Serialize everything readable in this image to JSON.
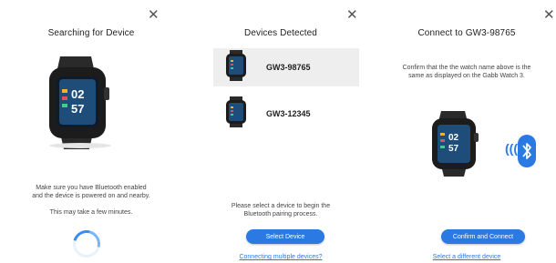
{
  "colors": {
    "accent": "#2b79e3",
    "selected_bg": "#eeeeee"
  },
  "search_panel": {
    "title": "Searching for Device",
    "close_icon": "close-icon",
    "watch_time_hour": "02",
    "watch_time_min": "57",
    "message_line1": "Make sure you have Bluetooth enabled",
    "message_line2": "and the device is powered on and nearby.",
    "wait_message": "This may take a few minutes."
  },
  "devices_panel": {
    "title": "Devices Detected",
    "close_icon": "close-icon",
    "devices": [
      {
        "name": "GW3-98765",
        "selected": true
      },
      {
        "name": "GW3-12345",
        "selected": false
      }
    ],
    "instruction_line1": "Please select a device to begin the",
    "instruction_line2": "Bluetooth pairing process.",
    "select_button": "Select Device",
    "multiple_link": "Connecting multiple devices?"
  },
  "connect_panel": {
    "title": "Connect to GW3-98765",
    "close_icon": "close-icon",
    "confirm_line1": "Confirm that the the watch name above is the",
    "confirm_line2": "same as displayed on the Gabb Watch 3.",
    "bluetooth_icon": "bluetooth-icon",
    "confirm_button": "Confirm and Connect",
    "different_link": "Select a different device"
  }
}
